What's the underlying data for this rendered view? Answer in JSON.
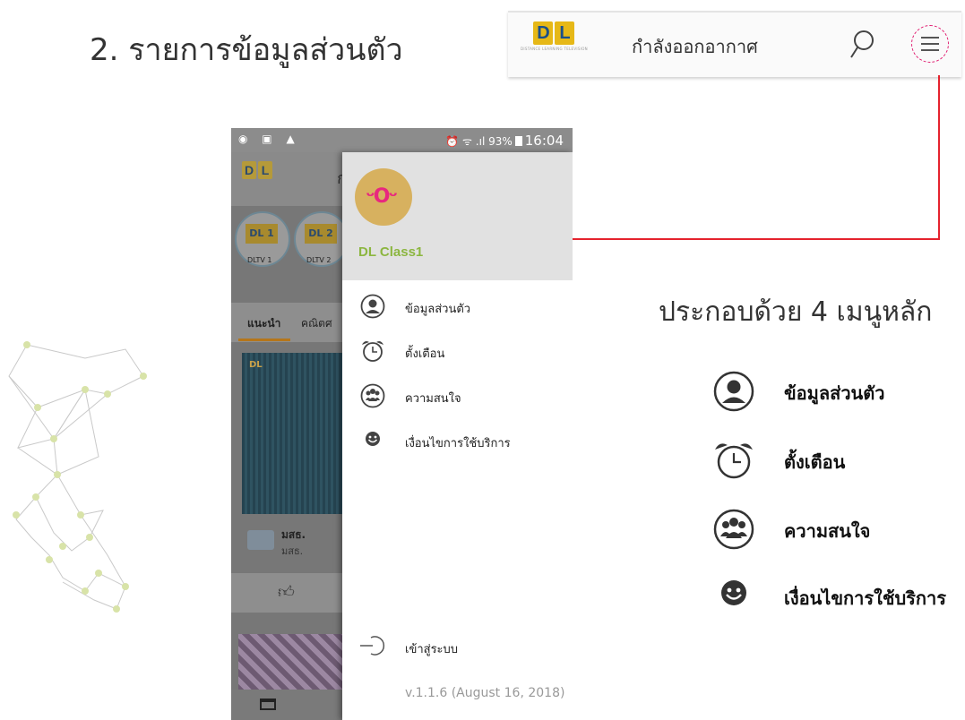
{
  "slide": {
    "title": "2. รายการข้อมูลส่วนตัว",
    "caption": "ประกอบด้วย 4 เมนูหลัก"
  },
  "topbar": {
    "logo_text": "DLTV",
    "logo_tagline": "DISTANCE LEARNING TELEVISION",
    "title": "กำลังออกอากาศ",
    "search_icon": "search-icon",
    "menu_icon": "hamburger-menu-icon",
    "highlight_color": "#e01a6e"
  },
  "connector": {
    "color": "#e5232e"
  },
  "phone": {
    "statusbar": {
      "left_icons": "◉ ▣ ▲",
      "right_icons": "⏰ ᯤ .ıl 93%",
      "time": "16:04"
    },
    "background": {
      "title_fragment": "กำ",
      "channels": [
        {
          "badge": "DL 1",
          "label": "DLTV 1"
        },
        {
          "badge": "DL 2",
          "label": "DLTV 2"
        }
      ],
      "tabs": [
        "แนะนำ",
        "คณิตศ"
      ],
      "video_logo": "DL",
      "program_name": "มสธ.",
      "program_sub": "มสธ."
    },
    "drawer": {
      "username": "DL Class1",
      "items": [
        {
          "label": "ข้อมูลส่วนตัว",
          "icon": "profile-icon"
        },
        {
          "label": "ตั้งเตือน",
          "icon": "alarm-clock-icon"
        },
        {
          "label": "ความสนใจ",
          "icon": "group-interest-icon"
        },
        {
          "label": "เงื่อนไขการใช้บริการ",
          "icon": "smiley-terms-icon"
        }
      ],
      "login_label": "เข้าสู่ระบบ",
      "version": "v.1.1.6 (August 16, 2018)",
      "accent_color": "#8cb640"
    }
  },
  "right_menu": {
    "items": [
      {
        "label": "ข้อมูลส่วนตัว",
        "icon": "profile-icon"
      },
      {
        "label": "ตั้งเตือน",
        "icon": "alarm-clock-icon"
      },
      {
        "label": "ความสนใจ",
        "icon": "group-interest-icon"
      },
      {
        "label": "เงื่อนไขการใช้บริการ",
        "icon": "smiley-terms-icon"
      }
    ]
  }
}
